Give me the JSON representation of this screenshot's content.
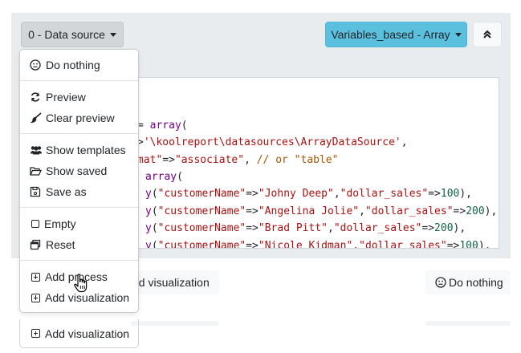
{
  "toolbar": {
    "datasource_label": "0 - Data source",
    "variables_label": "Variables_based - Array",
    "collapse_icon": "double-chevron-up-icon",
    "accent_color": "#5bc0de"
  },
  "code": {
    "lines": [
      [
        {
          "t": "= ",
          "c": "op"
        },
        {
          "t": "array",
          "c": "kw"
        },
        {
          "t": "(",
          "c": "op"
        }
      ],
      [
        {
          "t": ">",
          "c": "op"
        },
        {
          "t": "'\\koolreport\\datasources\\ArrayDataSource'",
          "c": "str"
        },
        {
          "t": ",",
          "c": "op"
        }
      ],
      [
        {
          "t": "mat\"",
          "c": "str"
        },
        {
          "t": "=>",
          "c": "op"
        },
        {
          "t": "\"associate\"",
          "c": "str"
        },
        {
          "t": ", ",
          "c": "op"
        },
        {
          "t": "// or \"table\"",
          "c": "cm"
        }
      ],
      [
        {
          "t": "array",
          "c": "kw"
        },
        {
          "t": "(",
          "c": "op"
        }
      ],
      [
        {
          "t": "y",
          "c": "kw"
        },
        {
          "t": "(",
          "c": "op"
        },
        {
          "t": "\"customerName\"",
          "c": "str"
        },
        {
          "t": "=>",
          "c": "op"
        },
        {
          "t": "\"Johny Deep\"",
          "c": "str"
        },
        {
          "t": ",",
          "c": "op"
        },
        {
          "t": "\"dollar_sales\"",
          "c": "str"
        },
        {
          "t": "=>",
          "c": "op"
        },
        {
          "t": "100",
          "c": "num"
        },
        {
          "t": "),",
          "c": "op"
        }
      ],
      [
        {
          "t": "y",
          "c": "kw"
        },
        {
          "t": "(",
          "c": "op"
        },
        {
          "t": "\"customerName\"",
          "c": "str"
        },
        {
          "t": "=>",
          "c": "op"
        },
        {
          "t": "\"Angelina Jolie\"",
          "c": "str"
        },
        {
          "t": ",",
          "c": "op"
        },
        {
          "t": "\"dollar_sales\"",
          "c": "str"
        },
        {
          "t": "=>",
          "c": "op"
        },
        {
          "t": "200",
          "c": "num"
        },
        {
          "t": "),",
          "c": "op"
        }
      ],
      [
        {
          "t": "y",
          "c": "kw"
        },
        {
          "t": "(",
          "c": "op"
        },
        {
          "t": "\"customerName\"",
          "c": "str"
        },
        {
          "t": "=>",
          "c": "op"
        },
        {
          "t": "\"Brad Pitt\"",
          "c": "str"
        },
        {
          "t": ",",
          "c": "op"
        },
        {
          "t": "\"dollar_sales\"",
          "c": "str"
        },
        {
          "t": "=>",
          "c": "op"
        },
        {
          "t": "200",
          "c": "num"
        },
        {
          "t": "),",
          "c": "op"
        }
      ],
      [
        {
          "t": "y",
          "c": "kw"
        },
        {
          "t": "(",
          "c": "op"
        },
        {
          "t": "\"customerName\"",
          "c": "str"
        },
        {
          "t": "=>",
          "c": "op"
        },
        {
          "t": "\"Nicole Kidman\"",
          "c": "str"
        },
        {
          "t": ",",
          "c": "op"
        },
        {
          "t": "\"dollar_sales\"",
          "c": "str"
        },
        {
          "t": "=>",
          "c": "op"
        },
        {
          "t": "100",
          "c": "num"
        },
        {
          "t": "),",
          "c": "op"
        }
      ]
    ]
  },
  "below": {
    "add_visualization_partial": "dd visualization",
    "do_nothing_label": "Do nothing"
  },
  "dropdown": {
    "do_nothing": "Do nothing",
    "preview": "Preview",
    "clear_preview": "Clear preview",
    "show_templates": "Show templates",
    "show_saved": "Show saved",
    "save_as": "Save as",
    "empty": "Empty",
    "reset": "Reset",
    "add_process": "Add process",
    "add_visualization": "Add visualization"
  },
  "extra": {
    "add_visualization": "Add visualization"
  }
}
